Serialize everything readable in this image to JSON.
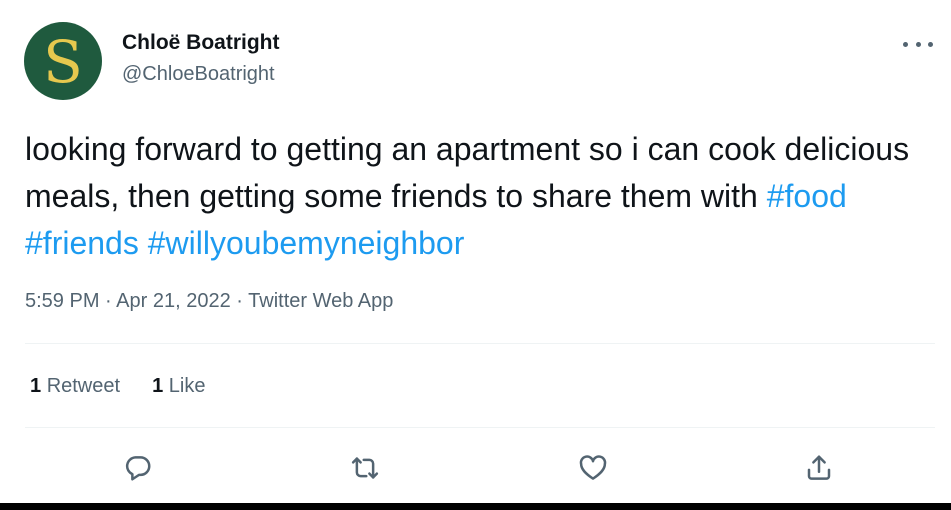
{
  "author": {
    "avatar_letter": "S",
    "avatar_bg": "#1f5a3e",
    "avatar_fg": "#e6c84e",
    "name": "Chloë Boatright",
    "handle": "@ChloeBoatright"
  },
  "tweet": {
    "text": "looking forward to getting an apartment so i can cook delicious meals, then getting some friends to share them with",
    "hashtags": [
      "#food",
      "#friends",
      "#willyoubemyneighbor"
    ],
    "time": "5:59 PM",
    "separator": "·",
    "date": "Apr 21, 2022",
    "source": "Twitter Web App"
  },
  "stats": {
    "retweets_count": "1",
    "retweets_label": "Retweet",
    "likes_count": "1",
    "likes_label": "Like"
  },
  "actions": [
    "reply-icon",
    "retweet-icon",
    "like-icon",
    "share-icon"
  ],
  "colors": {
    "text": "#0f1419",
    "secondary": "#536471",
    "link": "#1d9bf0",
    "divider": "#eff3f4",
    "bottom_bar": "#000000"
  }
}
